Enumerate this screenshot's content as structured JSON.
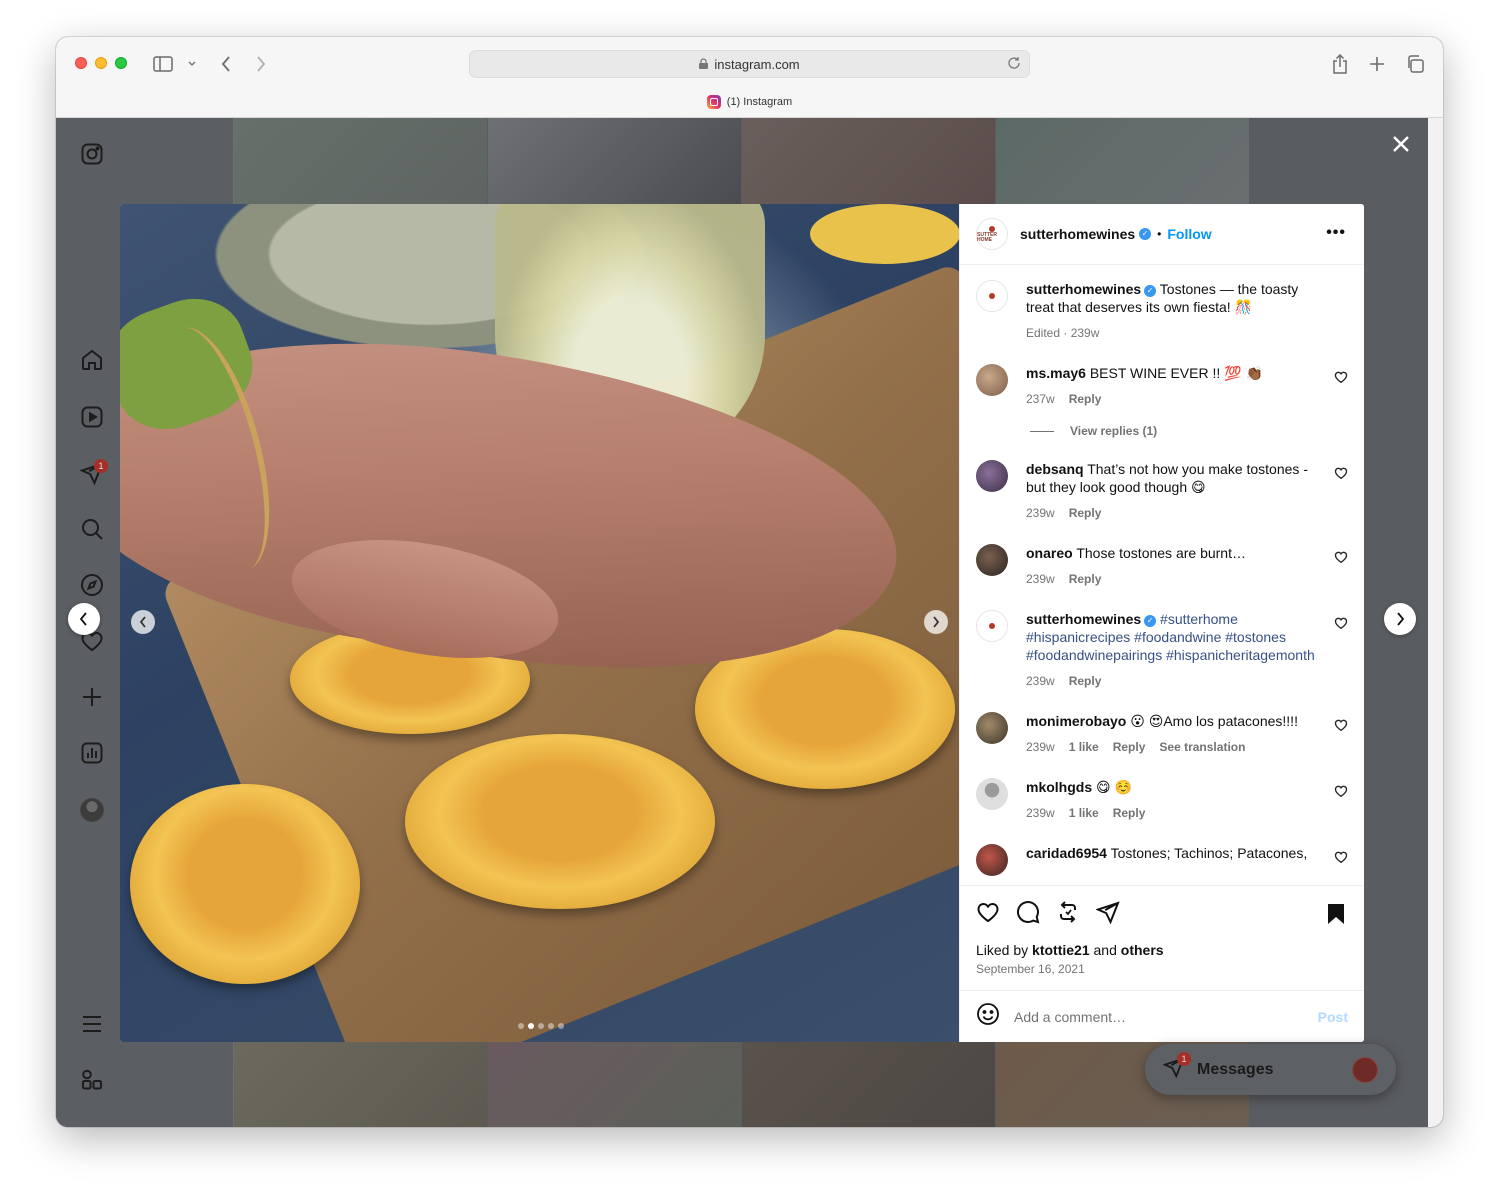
{
  "browser": {
    "url": "instagram.com",
    "tab_title": "(1) Instagram"
  },
  "sidebar": {
    "items": [
      {
        "icon": "instagram-icon"
      },
      {
        "icon": "home-icon"
      },
      {
        "icon": "reels-icon"
      },
      {
        "icon": "direct-icon",
        "badge": "1"
      },
      {
        "icon": "search-icon"
      },
      {
        "icon": "explore-icon"
      },
      {
        "icon": "heart-icon"
      },
      {
        "icon": "create-icon"
      },
      {
        "icon": "dashboard-icon"
      },
      {
        "icon": "profile-avatar"
      },
      {
        "icon": "menu-icon"
      },
      {
        "icon": "threads-icon"
      }
    ]
  },
  "post": {
    "author": "sutterhomewines",
    "follow_label": "Follow",
    "avatar_text": "SUTTER HOME",
    "photo_dots": 5,
    "photo_active_dot": 1
  },
  "comments": [
    {
      "user": "sutterhomewines",
      "verified": true,
      "text": "Tostones — the toasty treat that deserves its own fiesta! 🎊",
      "meta": [
        "Edited · 239w"
      ],
      "caption": true
    },
    {
      "user": "ms.may6",
      "text": "BEST WINE EVER !! 💯 👏🏾",
      "meta": [
        "237w",
        "Reply"
      ],
      "replies": "View replies (1)"
    },
    {
      "user": "debsanq",
      "text": "That’s not how you make tostones - but they look good though 😋",
      "meta": [
        "239w",
        "Reply"
      ]
    },
    {
      "user": "onareo",
      "text": "Those tostones are burnt…",
      "meta": [
        "239w",
        "Reply"
      ]
    },
    {
      "user": "sutterhomewines",
      "verified": true,
      "text": "#sutterhome #hispanicrecipes #foodandwine #tostones #foodandwinepairings #hispanicheritagemonth",
      "meta": [
        "239w",
        "Reply"
      ]
    },
    {
      "user": "monimerobayo",
      "text": "😮 😍Amo los patacones!!!!",
      "meta": [
        "239w",
        "1 like",
        "Reply",
        "See translation"
      ]
    },
    {
      "user": "mkolhgds",
      "text": "😋 ☺️",
      "meta": [
        "239w",
        "1 like",
        "Reply"
      ]
    },
    {
      "user": "caridad6954",
      "text": "Tostones; Tachinos; Patacones,",
      "meta": []
    }
  ],
  "actions": {
    "liked_prefix": "Liked by",
    "liked_user": "ktottie21",
    "liked_and": "and",
    "liked_others": "others",
    "date": "September 16, 2021"
  },
  "comment_box": {
    "placeholder": "Add a comment…",
    "post_label": "Post"
  },
  "messages": {
    "label": "Messages",
    "badge": "1"
  }
}
